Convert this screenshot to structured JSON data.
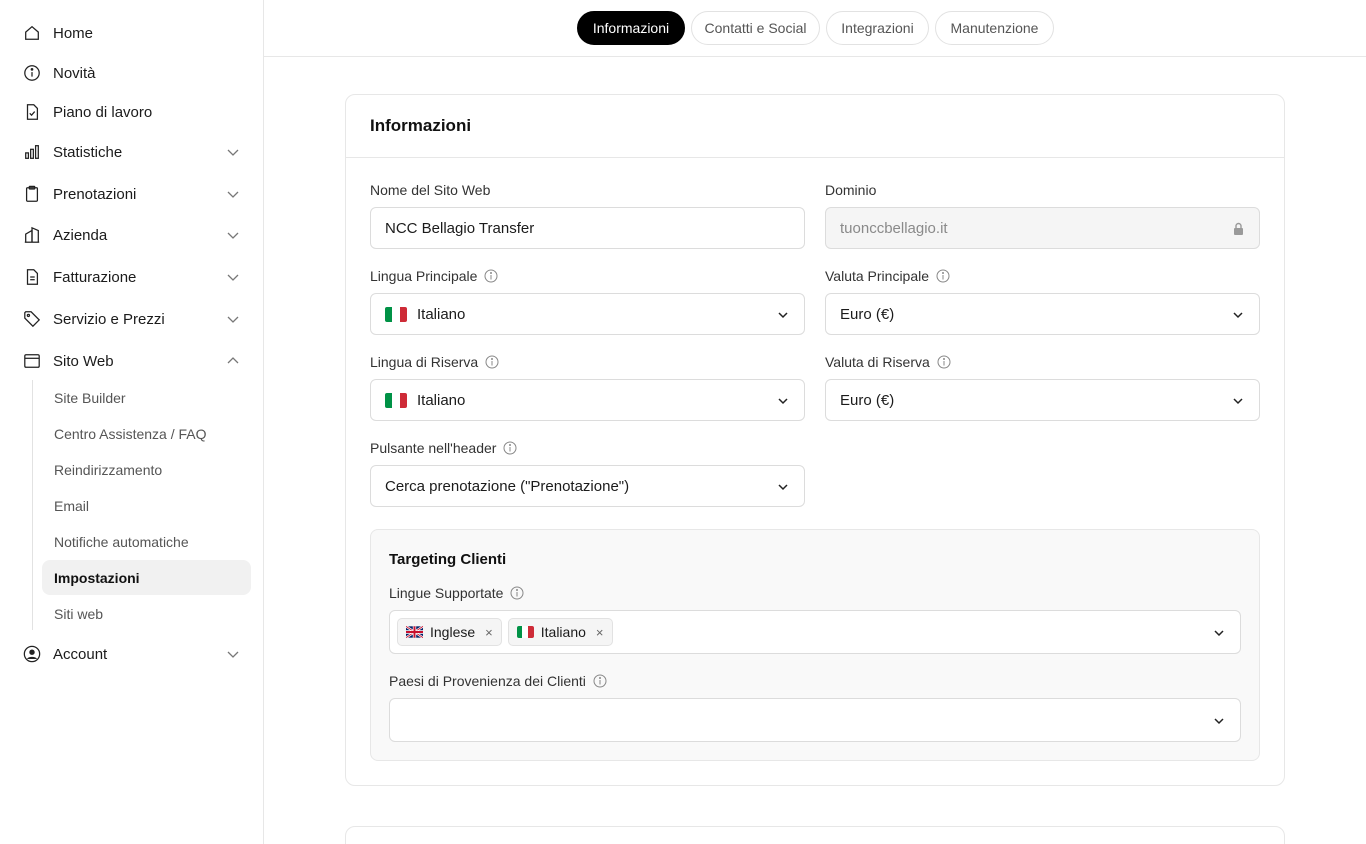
{
  "sidebar": {
    "items": [
      {
        "label": "Home",
        "icon": "home-icon"
      },
      {
        "label": "Novità",
        "icon": "info-circle-icon"
      },
      {
        "label": "Piano di lavoro",
        "icon": "document-check-icon"
      },
      {
        "label": "Statistiche",
        "icon": "bar-chart-icon"
      },
      {
        "label": "Prenotazioni",
        "icon": "clipboard-icon"
      },
      {
        "label": "Azienda",
        "icon": "building-icon"
      },
      {
        "label": "Fatturazione",
        "icon": "invoice-icon"
      },
      {
        "label": "Servizio e Prezzi",
        "icon": "tag-icon"
      },
      {
        "label": "Sito Web",
        "icon": "browser-window-icon"
      },
      {
        "label": "Account",
        "icon": "user-circle-icon"
      }
    ],
    "sub_items": [
      {
        "label": "Site Builder"
      },
      {
        "label": "Centro Assistenza / FAQ"
      },
      {
        "label": "Reindirizzamento"
      },
      {
        "label": "Email"
      },
      {
        "label": "Notifiche automatiche"
      },
      {
        "label": "Impostazioni"
      },
      {
        "label": "Siti web"
      }
    ]
  },
  "tabs": [
    {
      "label": "Informazioni"
    },
    {
      "label": "Contatti e Social"
    },
    {
      "label": "Integrazioni"
    },
    {
      "label": "Manutenzione"
    }
  ],
  "card": {
    "title": "Informazioni",
    "site_name": {
      "label": "Nome del Sito Web",
      "value": "NCC Bellagio Transfer"
    },
    "domain": {
      "label": "Dominio",
      "value": "tuonccbellagio.it"
    },
    "primary_language": {
      "label": "Lingua Principale",
      "value": "Italiano"
    },
    "primary_currency": {
      "label": "Valuta Principale",
      "value": "Euro (€)"
    },
    "fallback_language": {
      "label": "Lingua di Riserva",
      "value": "Italiano"
    },
    "fallback_currency": {
      "label": "Valuta di Riserva",
      "value": "Euro (€)"
    },
    "header_button": {
      "label": "Pulsante nell'header",
      "value": "Cerca prenotazione (\"Prenotazione\")"
    },
    "targeting": {
      "title": "Targeting Clienti",
      "languages_label": "Lingue Supportate",
      "languages": [
        "Inglese",
        "Italiano"
      ],
      "countries_label": "Paesi di Provenienza dei Clienti",
      "remove_symbol": "×"
    }
  },
  "colors": {
    "active_tab_bg": "#000000",
    "active_sub_bg": "#f1f1f1",
    "border": "#e7e7e7",
    "flag_green": "#009246",
    "flag_white": "#ffffff",
    "flag_red": "#ce2b37"
  }
}
